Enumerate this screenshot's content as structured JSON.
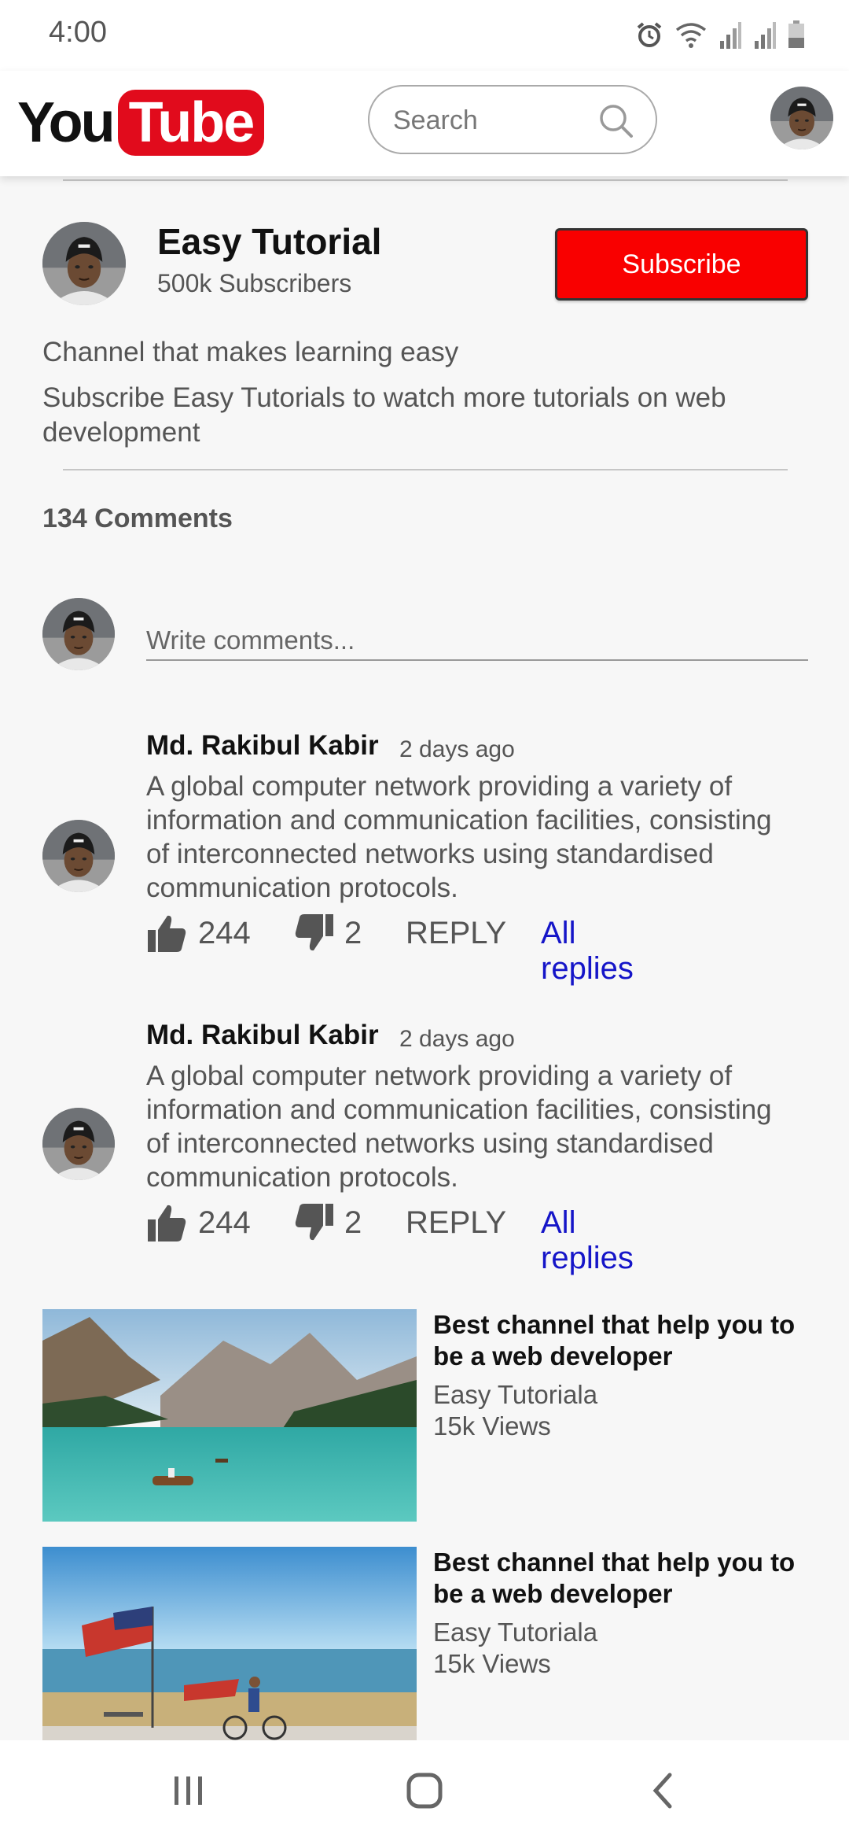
{
  "status_bar": {
    "time": "4:00"
  },
  "header": {
    "logo_you": "You",
    "logo_tube": "Tube",
    "search_placeholder": "Search"
  },
  "channel": {
    "name": "Easy Tutorial",
    "subscribers": "500k Subscribers",
    "subscribe_label": "Subscribe",
    "description_line1": "Channel that makes learning easy",
    "description_line2": "Subscribe Easy Tutorials to watch more tutorials on web development"
  },
  "comments": {
    "count_label": "134 Comments",
    "input_placeholder": "Write comments...",
    "items": [
      {
        "author": "Md. Rakibul Kabir",
        "time": "2 days ago",
        "text": "A global computer network providing a variety of information and communication facilities, consisting of interconnected networks using standardised communication protocols.",
        "likes": "244",
        "dislikes": "2",
        "reply_label": "REPLY",
        "all_replies_label": "All replies"
      },
      {
        "author": "Md. Rakibul Kabir",
        "time": "2 days ago",
        "text": "A global computer network providing a variety of information and communication facilities, consisting of interconnected networks using standardised communication protocols.",
        "likes": "244",
        "dislikes": "2",
        "reply_label": "REPLY",
        "all_replies_label": "All replies"
      }
    ]
  },
  "videos": [
    {
      "title": "Best channel that help you to be a web developer",
      "channel": "Easy Tutoriala",
      "views": "15k Views"
    },
    {
      "title": "Best channel that help you to be a web developer",
      "channel": "Easy Tutoriala",
      "views": "15k Views"
    }
  ],
  "icons": {
    "status": [
      "alarm-icon",
      "wifi-icon",
      "signal-icon",
      "signal-icon",
      "battery-icon"
    ],
    "search": "search-icon",
    "like": "thumbs-up-icon",
    "dislike": "thumbs-down-icon",
    "nav": [
      "recents-icon",
      "home-icon",
      "back-icon"
    ]
  },
  "colors": {
    "brand_red": "#e10b1c",
    "subscribe_red": "#f90000",
    "link_blue": "#1515c8"
  }
}
